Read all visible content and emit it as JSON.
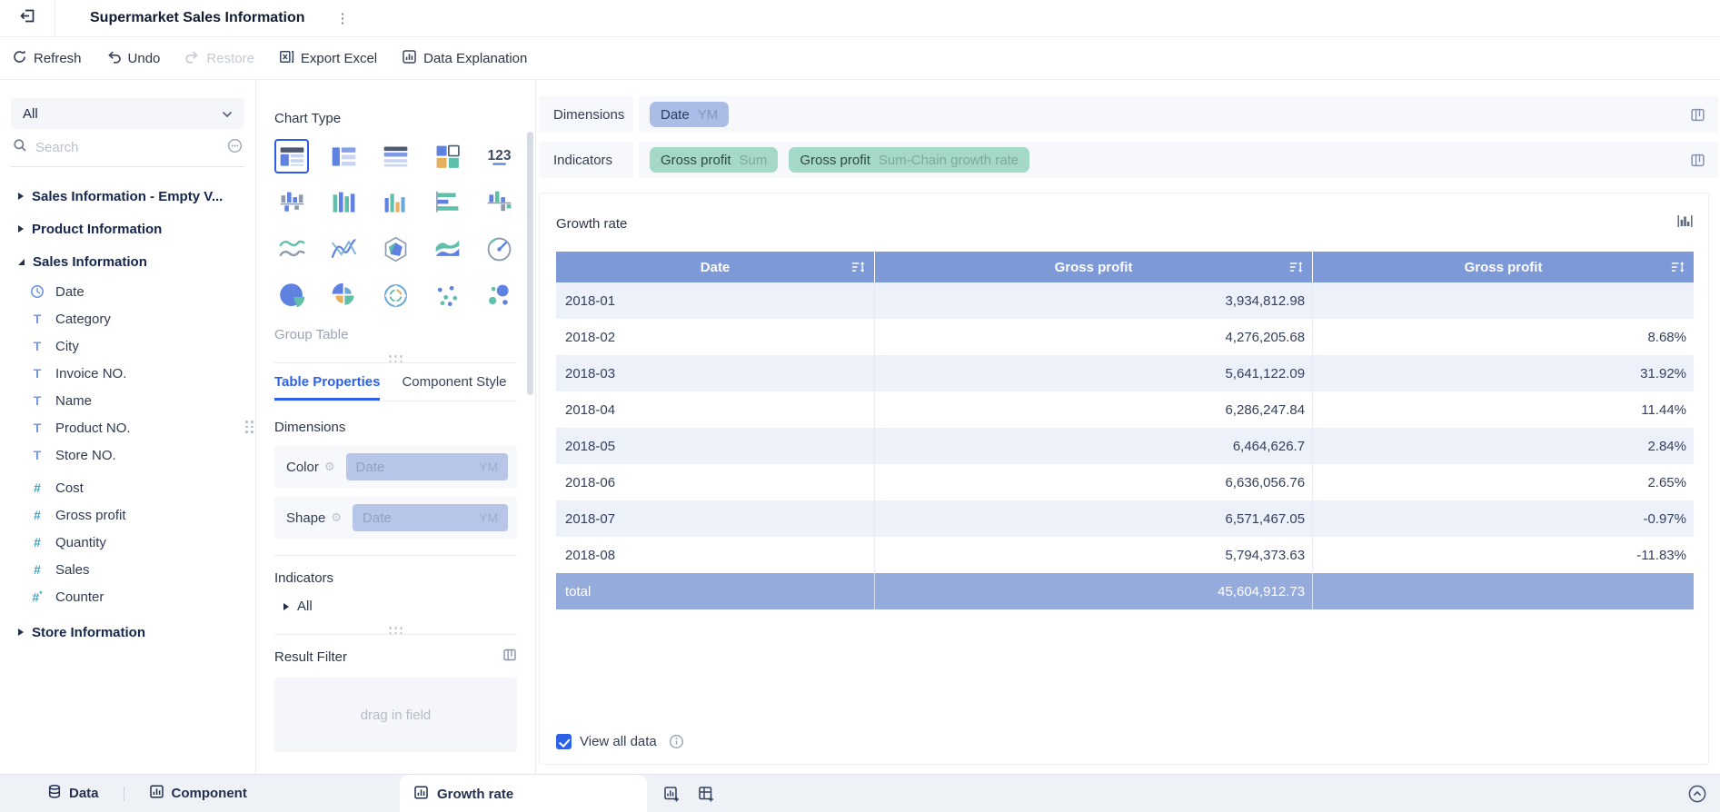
{
  "topbar": {
    "title": "Supermarket Sales Information"
  },
  "toolbar": {
    "refresh": "Refresh",
    "undo": "Undo",
    "restore": "Restore",
    "export_excel": "Export Excel",
    "data_explanation": "Data Explanation"
  },
  "sidebar": {
    "scope_select": "All",
    "search_placeholder": "Search",
    "tree": [
      {
        "label": "Sales Information - Empty V...",
        "type": "folder",
        "state": "collapsed"
      },
      {
        "label": "Product Information",
        "type": "folder",
        "state": "collapsed"
      },
      {
        "label": "Sales Information",
        "type": "folder",
        "state": "expanded"
      },
      {
        "label": "Date",
        "type": "date"
      },
      {
        "label": "Category",
        "type": "text"
      },
      {
        "label": "City",
        "type": "text"
      },
      {
        "label": "Invoice NO.",
        "type": "text"
      },
      {
        "label": "Name",
        "type": "text"
      },
      {
        "label": "Product NO.",
        "type": "text"
      },
      {
        "label": "Store NO.",
        "type": "text",
        "gap_after": true
      },
      {
        "label": "Cost",
        "type": "number"
      },
      {
        "label": "Gross profit",
        "type": "number"
      },
      {
        "label": "Quantity",
        "type": "number"
      },
      {
        "label": "Sales",
        "type": "number"
      },
      {
        "label": "Counter",
        "type": "counter",
        "gap_after": true
      },
      {
        "label": "Store Information",
        "type": "folder",
        "state": "collapsed"
      }
    ]
  },
  "panel": {
    "chart_type_label": "Chart Type",
    "chart_types": [
      {
        "name": "group-table",
        "selected": true
      },
      {
        "name": "cross-table"
      },
      {
        "name": "detail-table"
      },
      {
        "name": "block-chart"
      },
      {
        "name": "kpi-card"
      },
      {
        "name": "waterfall-bar"
      },
      {
        "name": "multi-column"
      },
      {
        "name": "column-chart"
      },
      {
        "name": "horizontal-bar"
      },
      {
        "name": "bidirectional-bar"
      },
      {
        "name": "line-area"
      },
      {
        "name": "line-chart"
      },
      {
        "name": "radar-chart"
      },
      {
        "name": "area-chart"
      },
      {
        "name": "gauge-chart"
      },
      {
        "name": "pie-chart"
      },
      {
        "name": "rose-chart"
      },
      {
        "name": "donut-map"
      },
      {
        "name": "scatter-chart"
      },
      {
        "name": "bubble-chart"
      }
    ],
    "selected_chart_name": "Group Table",
    "tabs": {
      "properties": "Table Properties",
      "style": "Component Style"
    },
    "dimensions_label": "Dimensions",
    "color_label": "Color",
    "shape_label": "Shape",
    "color_chip": {
      "label": "Date",
      "tag": "YM"
    },
    "shape_chip": {
      "label": "Date",
      "tag": "YM"
    },
    "indicators_label": "Indicators",
    "indicators_all": "All",
    "result_filter_label": "Result Filter",
    "drop_hint": "drag in field"
  },
  "canvas": {
    "dimensions_label": "Dimensions",
    "dimension_chips": [
      {
        "label": "Date",
        "tag": "YM",
        "color": "blue"
      }
    ],
    "indicators_label": "Indicators",
    "indicator_chips": [
      {
        "label": "Gross profit",
        "tag": "Sum",
        "color": "green"
      },
      {
        "label": "Gross profit",
        "tag": "Sum-Chain growth rate",
        "color": "green"
      }
    ],
    "card_title": "Growth rate",
    "view_all_label": "View all data"
  },
  "table": {
    "columns": [
      "Date",
      "Gross profit",
      "Gross profit"
    ],
    "rows": [
      [
        "2018-01",
        "3,934,812.98",
        ""
      ],
      [
        "2018-02",
        "4,276,205.68",
        "8.68%"
      ],
      [
        "2018-03",
        "5,641,122.09",
        "31.92%"
      ],
      [
        "2018-04",
        "6,286,247.84",
        "11.44%"
      ],
      [
        "2018-05",
        "6,464,626.7",
        "2.84%"
      ],
      [
        "2018-06",
        "6,636,056.76",
        "2.65%"
      ],
      [
        "2018-07",
        "6,571,467.05",
        "-0.97%"
      ],
      [
        "2018-08",
        "5,794,373.63",
        "-11.83%"
      ]
    ],
    "total_row": [
      "total",
      "45,604,912.73",
      ""
    ]
  },
  "bottombar": {
    "data_label": "Data",
    "component_label": "Component",
    "active_tab_label": "Growth rate"
  },
  "colors": {
    "accent_blue": "#2d62e8",
    "table_header": "#7d99d8",
    "table_total": "#95abdc",
    "row_alt": "#edf1f9",
    "chip_blue": "#a9bde6",
    "chip_green": "#a5d9c7",
    "icon_teal": "#3aa7c9",
    "icon_blue": "#7196e3"
  }
}
